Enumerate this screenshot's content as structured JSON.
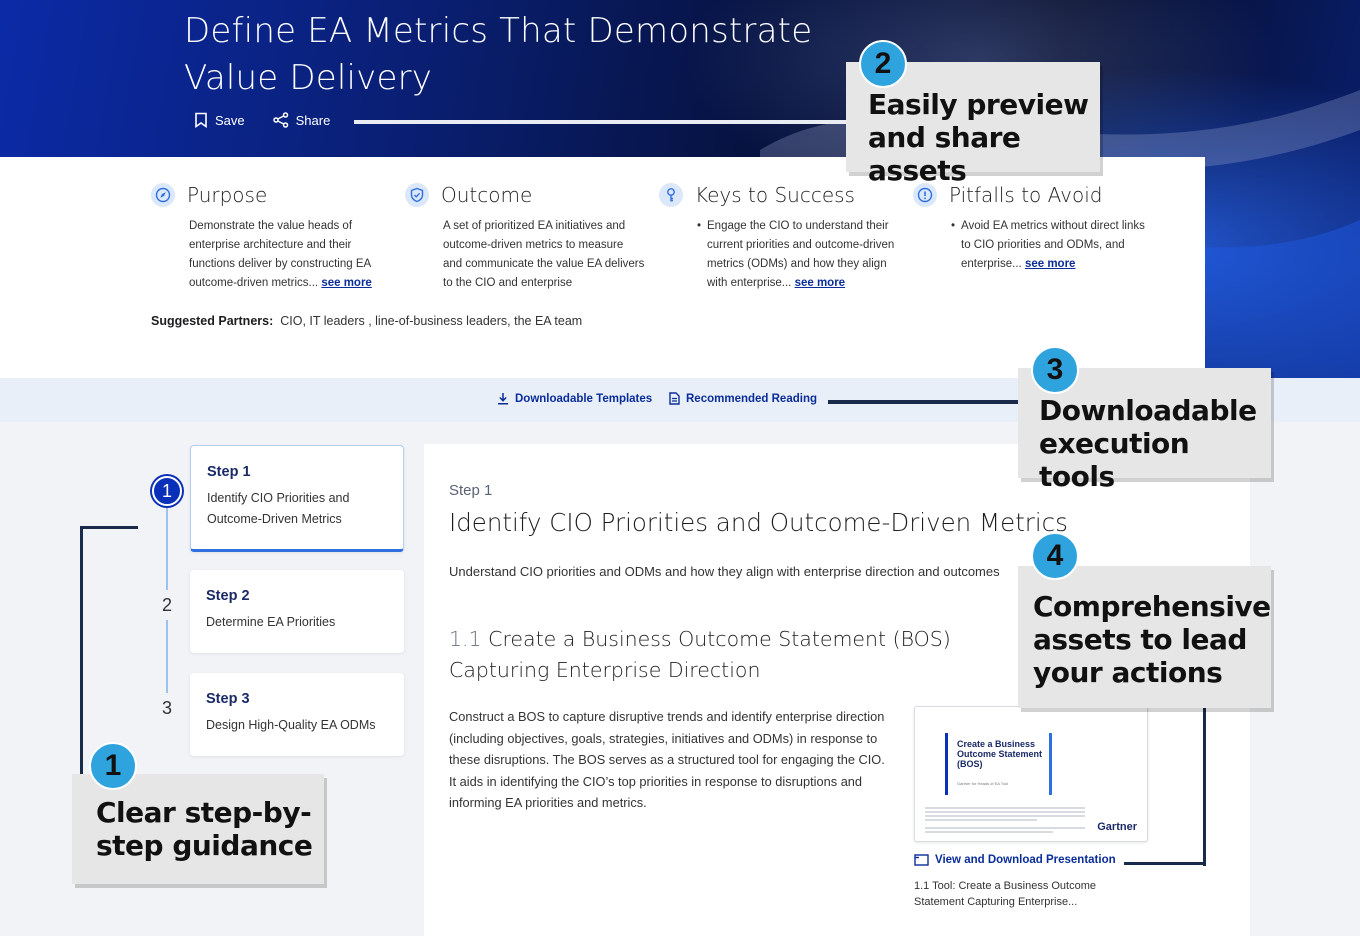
{
  "hero": {
    "title": "Define EA Metrics That Demonstrate Value Delivery",
    "save_label": "Save",
    "share_label": "Share"
  },
  "summary": {
    "columns": [
      {
        "title": "Purpose",
        "icon": "compass-icon",
        "text": "Demonstrate the value heads of enterprise architecture and their functions deliver by constructing EA outcome-driven metrics...",
        "more": "see more",
        "bullet": false
      },
      {
        "title": "Outcome",
        "icon": "shield-check-icon",
        "text": "A set of prioritized EA initiatives and outcome-driven metrics to measure and communicate the value EA delivers to the CIO and enterprise",
        "more": "",
        "bullet": false
      },
      {
        "title": "Keys to Success",
        "icon": "key-icon",
        "text": "Engage the CIO to understand their current priorities and outcome-driven metrics (ODMs) and how they align with enterprise...",
        "more": "see more",
        "bullet": true
      },
      {
        "title": "Pitfalls to Avoid",
        "icon": "alert-icon",
        "text": "Avoid EA metrics without direct links to CIO priorities and ODMs, and enterprise...",
        "more": "see more",
        "bullet": true
      }
    ],
    "partners_label": "Suggested Partners:",
    "partners_value": "CIO, IT leaders , line-of-business leaders, the EA team"
  },
  "resources": {
    "templates_label": "Downloadable Templates",
    "reading_label": "Recommended Reading"
  },
  "steps": [
    {
      "num": "1",
      "label": "Step 1",
      "desc": "Identify CIO Priorities and Outcome-Driven Metrics",
      "active": true
    },
    {
      "num": "2",
      "label": "Step 2",
      "desc": "Determine EA Priorities",
      "active": false
    },
    {
      "num": "3",
      "label": "Step 3",
      "desc": "Design High-Quality EA ODMs",
      "active": false
    }
  ],
  "main": {
    "step_label": "Step 1",
    "title": "Identify CIO Priorities and Outcome-Driven Metrics",
    "intro": "Understand CIO priorities and ODMs and how they align with enterprise direction and outcomes",
    "sub_num": "1.1",
    "sub_title": "Create a Business Outcome Statement (BOS) Capturing Enterprise Direction",
    "body": "Construct a BOS to capture disruptive trends and identify enterprise direction (including objectives, goals, strategies, initiatives and ODMs) in response to these disruptions. The BOS serves as a structured tool for engaging the CIO. It aids in identifying the CIO’s top priorities in response to disruptions and informing EA priorities and metrics.",
    "thumb_title": "Create a Business Outcome Statement (BOS)",
    "thumb_sub": "Gartner for Heads of EA Tool",
    "thumb_brand": "Gartner",
    "view_label": "View and Download Presentation",
    "tool_caption": "1.1 Tool: Create a Business Outcome Statement Capturing Enterprise..."
  },
  "callouts": {
    "c1": {
      "num": "1",
      "text": "Clear step-by-step guidance"
    },
    "c2": {
      "num": "2",
      "text": "Easily preview and share assets"
    },
    "c3": {
      "num": "3",
      "text": "Downloadable execution tools"
    },
    "c4": {
      "num": "4",
      "text": "Comprehensive assets to lead your actions"
    }
  },
  "colors": {
    "brand_navy": "#0a2d99",
    "callout_badge": "#2ea3dd",
    "active_step": "#0a2fb8"
  }
}
